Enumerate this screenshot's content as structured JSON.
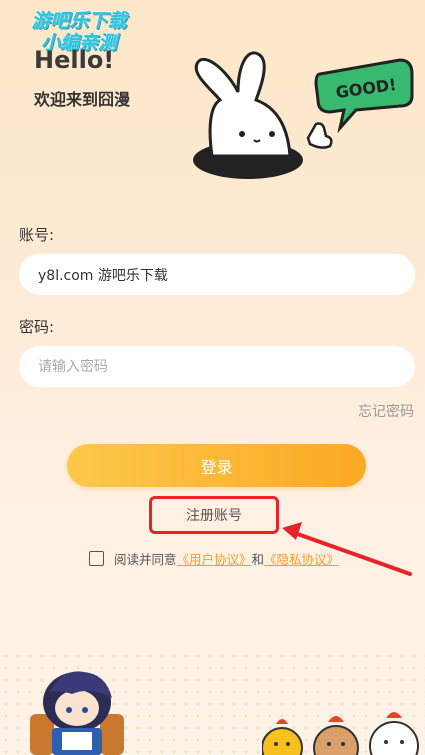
{
  "watermark": {
    "line1": "游吧乐下载",
    "line2": "小编亲测"
  },
  "header": {
    "hello": "Hello!",
    "welcome": "欢迎来到囧漫"
  },
  "bunny": {
    "speech": "GOOD!"
  },
  "form": {
    "account_label": "账号:",
    "account_value": "y8l.com 游吧乐下载",
    "password_label": "密码:",
    "password_placeholder": "请输入密码",
    "forgot_label": "忘记密码",
    "login_label": "登录",
    "register_label": "注册账号"
  },
  "agreement": {
    "prefix": "阅读并同意",
    "user_agreement": "《用户协议》",
    "and": "和",
    "privacy_policy": "《隐私协议》"
  },
  "colors": {
    "accent": "#fba924",
    "link": "#f3a02a",
    "highlight": "#e8222b"
  }
}
